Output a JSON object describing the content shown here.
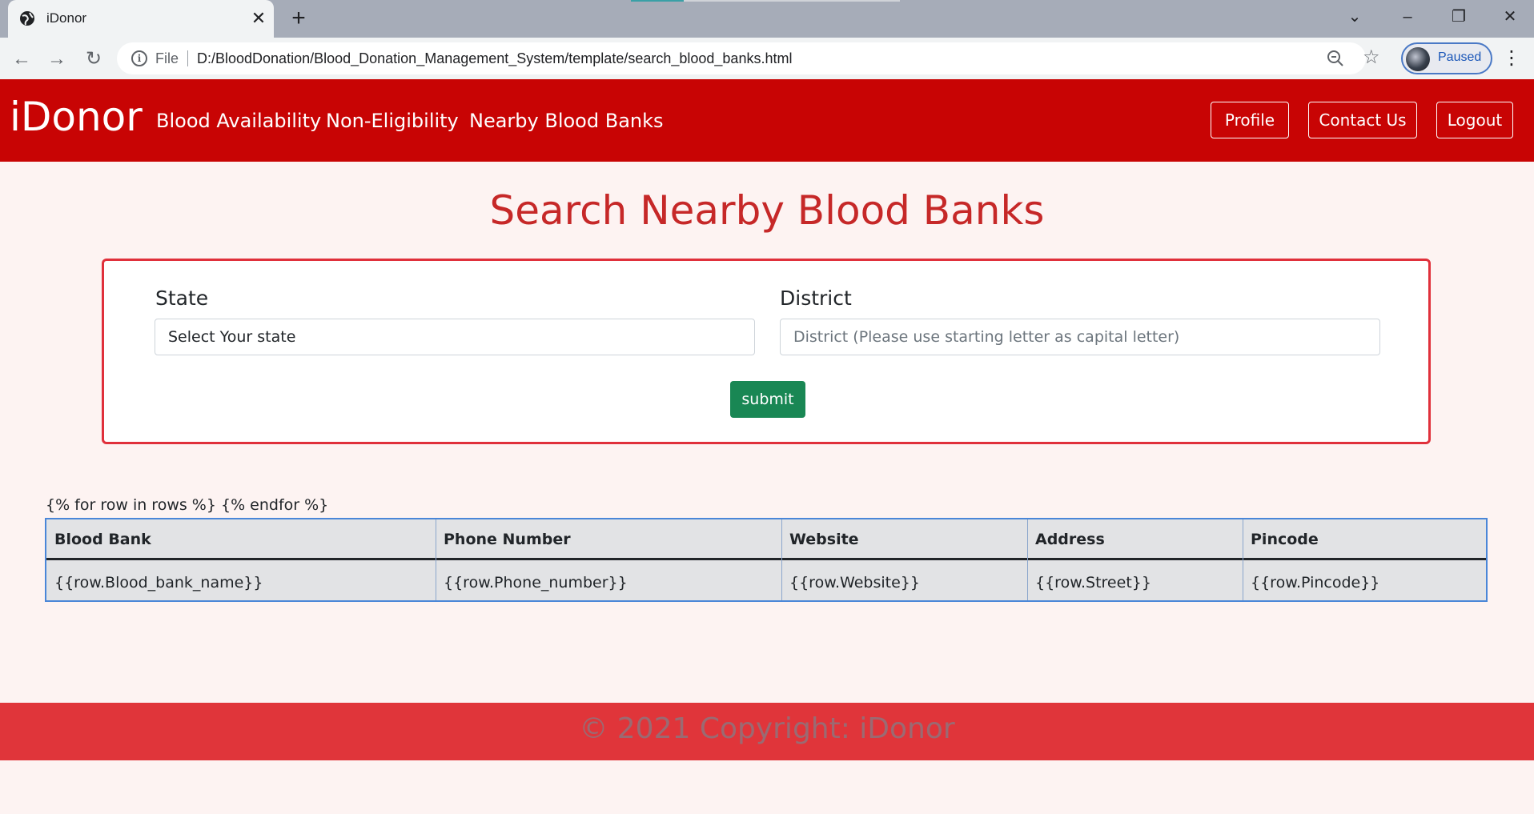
{
  "browser": {
    "tab_title": "iDonor",
    "address_scheme": "File",
    "url": "D:/BloodDonation/Blood_Donation_Management_System/template/search_blood_banks.html",
    "profile_status": "Paused"
  },
  "navbar": {
    "brand": "iDonor",
    "links": [
      "Blood Availability",
      "Non-Eligibility",
      "Nearby Blood Banks"
    ],
    "buttons": [
      "Profile",
      "Contact Us",
      "Logout"
    ]
  },
  "main": {
    "title": "Search Nearby Blood Banks",
    "state_label": "State",
    "state_value": "Select Your state",
    "district_label": "District",
    "district_placeholder": "District (Please use starting letter as capital letter)",
    "submit_label": "submit",
    "loop_text": "{% for row in rows %} {% endfor %}"
  },
  "table": {
    "headers": [
      "Blood Bank",
      "Phone Number",
      "Website",
      "Address",
      "Pincode"
    ],
    "rows": [
      [
        "{{row.Blood_bank_name}}",
        "{{row.Phone_number}}",
        "{{row.Website}}",
        "{{row.Street}}",
        "{{row.Pincode}}"
      ]
    ]
  },
  "footer": {
    "text": "© 2021 Copyright: iDonor"
  },
  "colors": {
    "navbar": "#c80404",
    "title": "#c62828",
    "card_border": "#e0303b",
    "submit": "#198754",
    "footer": "#e0353a"
  }
}
